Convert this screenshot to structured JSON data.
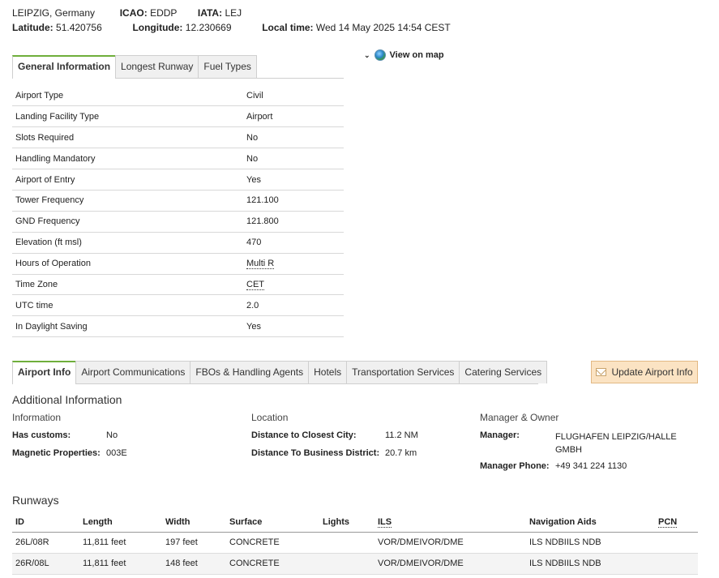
{
  "header": {
    "city": "LEIPZIG, Germany",
    "icao_label": "ICAO:",
    "icao": "EDDP",
    "iata_label": "IATA:",
    "iata": "LEJ",
    "lat_label": "Latitude:",
    "lat": "51.420756",
    "lon_label": "Longitude:",
    "lon": "12.230669",
    "time_label": "Local time:",
    "time": "Wed 14 May 2025 14:54 CEST"
  },
  "info_tabs": [
    "General Information",
    "Longest Runway",
    "Fuel Types"
  ],
  "map_link": "View on map",
  "general": [
    {
      "k": "Airport Type",
      "v": "Civil"
    },
    {
      "k": "Landing Facility Type",
      "v": "Airport"
    },
    {
      "k": "Slots Required",
      "v": "No"
    },
    {
      "k": "Handling Mandatory",
      "v": "No"
    },
    {
      "k": "Airport of Entry",
      "v": "Yes"
    },
    {
      "k": "Tower Frequency",
      "v": "121.100"
    },
    {
      "k": "GND Frequency",
      "v": "121.800"
    },
    {
      "k": "Elevation (ft msl)",
      "v": "470"
    },
    {
      "k": "Hours of Operation",
      "v": "Multi R"
    },
    {
      "k": "Time Zone",
      "v": "CET"
    },
    {
      "k": "UTC time",
      "v": "2.0"
    },
    {
      "k": "In Daylight Saving",
      "v": "Yes"
    }
  ],
  "airport_tabs": [
    "Airport Info",
    "Airport Communications",
    "FBOs & Handling Agents",
    "Hotels",
    "Transportation Services",
    "Catering Services"
  ],
  "update_button": "Update Airport Info",
  "additional": {
    "title": "Additional Information",
    "information": {
      "title": "Information",
      "customs_label": "Has customs:",
      "customs": "No",
      "magnetic_label": "Magnetic Properties:",
      "magnetic": "003E"
    },
    "location": {
      "title": "Location",
      "city_label": "Distance to Closest City:",
      "city": "11.2 NM",
      "business_label": "Distance To Business District:",
      "business": "20.7 km"
    },
    "manager": {
      "title": "Manager & Owner",
      "manager_label": "Manager:",
      "manager": "FLUGHAFEN LEIPZIG/HALLE GMBH",
      "phone_label": "Manager Phone:",
      "phone": "+49 341 224 1130"
    }
  },
  "runways": {
    "title": "Runways",
    "columns": [
      "ID",
      "Length",
      "Width",
      "Surface",
      "Lights",
      "ILS",
      "Navigation Aids",
      "PCN"
    ],
    "rows": [
      [
        "26L/08R",
        "11,811 feet",
        "197 feet",
        "CONCRETE",
        "",
        "VOR/DMEIVOR/DME",
        "ILS NDBIILS NDB",
        ""
      ],
      [
        "26R/08L",
        "11,811 feet",
        "148 feet",
        "CONCRETE",
        "",
        "VOR/DMEIVOR/DME",
        "ILS NDBIILS NDB",
        ""
      ]
    ]
  }
}
